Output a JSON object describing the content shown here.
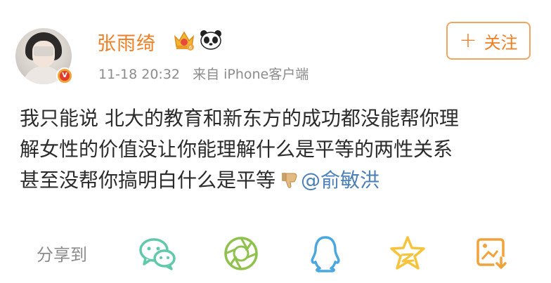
{
  "post": {
    "username": "张雨绮",
    "timestamp": "11-18 20:32",
    "source": "来自 iPhone客户端",
    "follow_label": "关注",
    "follow_plus": "+",
    "content_lines": [
      "我只能说 北大的教育和新东方的成功都没能帮你理",
      "解女性的价值没让你能理解什么是平等的两性关系",
      "甚至没帮你搞明白什么是平等"
    ],
    "mention": "@俞敏洪",
    "verified_badge": "V"
  },
  "share": {
    "label": "分享到",
    "targets": [
      {
        "name": "wechat-icon"
      },
      {
        "name": "moments-icon"
      },
      {
        "name": "qq-icon"
      },
      {
        "name": "qzone-icon"
      },
      {
        "name": "save-image-icon"
      }
    ]
  },
  "colors": {
    "accent": "#f07e23",
    "link": "#4a7fb8",
    "share_icons": "#5fc9a8",
    "moments_icon": "#8fc24c",
    "qq_icon": "#4aa7e0",
    "qzone_icon": "#f5c43a",
    "save_icon": "#f2a23a"
  }
}
